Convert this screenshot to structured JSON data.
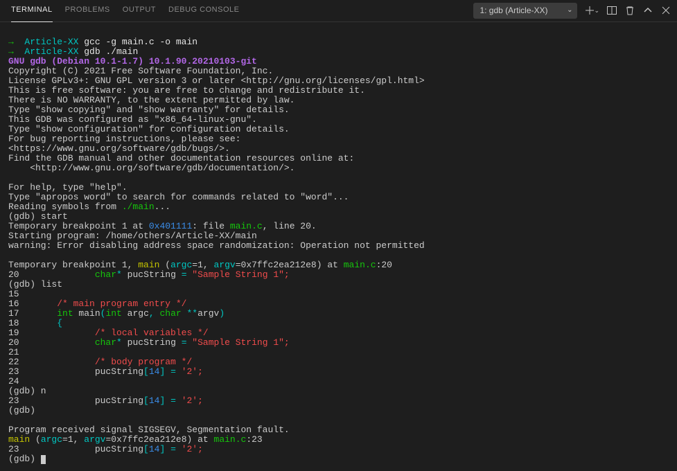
{
  "tabs": {
    "terminal": "TERMINAL",
    "problems": "PROBLEMS",
    "output": "OUTPUT",
    "debug": "DEBUG CONSOLE"
  },
  "dropdown": {
    "label": "1: gdb (Article-XX)"
  },
  "prompt": {
    "arrow": "→",
    "cwd": "Article-XX",
    "cmd1": "gcc -g main.c -o main",
    "cmd2": "gdb ./main"
  },
  "gdb": {
    "banner": "GNU gdb (Debian 10.1-1.7) 10.1.90.20210103-git",
    "copyright": "Copyright (C) 2021 Free Software Foundation, Inc.",
    "license": "License GPLv3+: GNU GPL version 3 or later <http://gnu.org/licenses/gpl.html>",
    "free1": "This is free software: you are free to change and redistribute it.",
    "free2": "There is NO WARRANTY, to the extent permitted by law.",
    "show1": "Type \"show copying\" and \"show warranty\" for details.",
    "config": "This GDB was configured as \"x86_64-linux-gnu\".",
    "show2": "Type \"show configuration\" for configuration details.",
    "bugs1": "For bug reporting instructions, please see:",
    "bugs2": "<https://www.gnu.org/software/gdb/bugs/>.",
    "docs1": "Find the GDB manual and other documentation resources online at:",
    "docs2": "    <http://www.gnu.org/software/gdb/documentation/>.",
    "help1": "For help, type \"help\".",
    "help2": "Type \"apropos word\" to search for commands related to \"word\"...",
    "reading_pre": "Reading symbols from ",
    "reading_path": "./main",
    "reading_post": "...",
    "prompt_start": "(gdb) start",
    "break_pre": "Temporary breakpoint 1 at ",
    "break_addr": "0x401111",
    "break_mid": ": file ",
    "break_file": "main.c",
    "break_post": ", line 20.",
    "starting": "Starting program: /home/others/Article-XX/main",
    "warning": "warning: Error disabling address space randomization: Operation not permitted",
    "hit_pre": "Temporary breakpoint 1, ",
    "main": "main",
    "paren_open": " (",
    "argc": "argc",
    "eq1": "=1, ",
    "argv": "argv",
    "eqaddr": "=0x7ffc2ea212e8) at ",
    "mainc": "main.c",
    "colon20": ":20",
    "line20pre": "20              ",
    "char": "char",
    "star": "*",
    "pucWhite": " pucString ",
    "eq": "= ",
    "str": "\"Sample String 1\";",
    "prompt_list": "(gdb) list",
    "l15": "15",
    "l16": "16       ",
    "c16": "/* main program entry */",
    "l17": "17       ",
    "int": "int",
    "mainw": " main",
    "lp": "(",
    "intw": "int",
    "argcw": " argc",
    "comma": ", ",
    "charw": "char",
    "starstar": " **",
    "argvw": "argv",
    "rp": ")",
    "l18": "18       ",
    "brace": "{",
    "l19": "19              ",
    "c19": "/* local variables */",
    "l20": "20              ",
    "l21": "21",
    "l22": "22              ",
    "c22": "/* body program */",
    "l23": "23              pucString",
    "bracket": "[",
    "idx": "14",
    "bracket2": "] ",
    "eq2": "= ",
    "ch2": "'2';",
    "l24": "24",
    "prompt_n": "(gdb) n",
    "l23b": "23              pucString",
    "prompt_empty": "(gdb)",
    "sigsegv": "Program received signal SIGSEGV, Segmentation fault.",
    "colon23": ":23",
    "gdb_final": "(gdb) "
  }
}
